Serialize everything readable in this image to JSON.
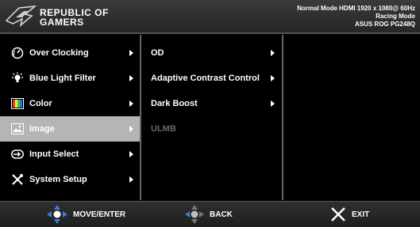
{
  "header": {
    "logo_line1": "REPUBLIC OF",
    "logo_line2": "GAMERS",
    "status_line1": "Normal Mode HDMI 1920 x 1080@ 60Hz",
    "status_line2": "Racing Mode",
    "status_line3": "ASUS ROG PG248Q"
  },
  "main_menu": [
    {
      "label": "Over Clocking",
      "icon": "speedometer-icon",
      "selected": false
    },
    {
      "label": "Blue Light Filter",
      "icon": "light-bulb-icon",
      "selected": false
    },
    {
      "label": "Color",
      "icon": "color-bars-icon",
      "selected": false
    },
    {
      "label": "Image",
      "icon": "image-icon",
      "selected": true
    },
    {
      "label": "Input Select",
      "icon": "input-icon",
      "selected": false
    },
    {
      "label": "System Setup",
      "icon": "tools-icon",
      "selected": false
    }
  ],
  "sub_menu": [
    {
      "label": "OD",
      "enabled": true
    },
    {
      "label": "Adaptive Contrast Control",
      "enabled": true
    },
    {
      "label": "Dark Boost",
      "enabled": true
    },
    {
      "label": "ULMB",
      "enabled": false
    }
  ],
  "footer": {
    "move_label": "MOVE/ENTER",
    "back_label": "BACK",
    "exit_label": "EXIT"
  },
  "colors": {
    "selected_bg": "#b5b5b5",
    "disabled_text": "#6a6a6a",
    "accent_blue": "#2f6fd6"
  }
}
